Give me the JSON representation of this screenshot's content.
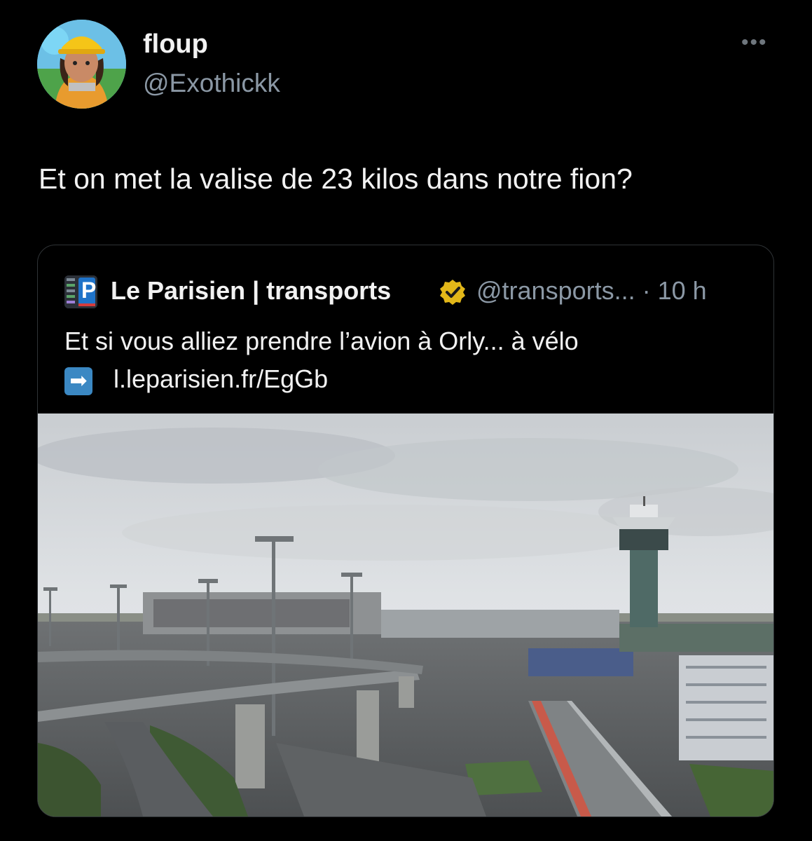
{
  "tweet": {
    "display_name": "floup",
    "handle": "@Exothickk",
    "more_label": "•••",
    "text": "Et on met la valise de 23 kilos dans notre fion?"
  },
  "quote": {
    "logo_letter": "P",
    "display_name": "Le Parisien | transports",
    "handle_time": "@transports... · 10 h",
    "text": "Et si vous alliez prendre l’avion à Orly... à vélo",
    "arrow": "➡",
    "link": "l.leparisien.fr/EgGb"
  },
  "icons": {
    "avatar": "construction-worker-avatar",
    "verified": "verified-badge-icon",
    "more": "more-icon"
  },
  "colors": {
    "background": "#000000",
    "text": "#f2f2f2",
    "secondary": "#8b98a5",
    "verified": "#e2b719",
    "arrow_box": "#3b88c3"
  }
}
